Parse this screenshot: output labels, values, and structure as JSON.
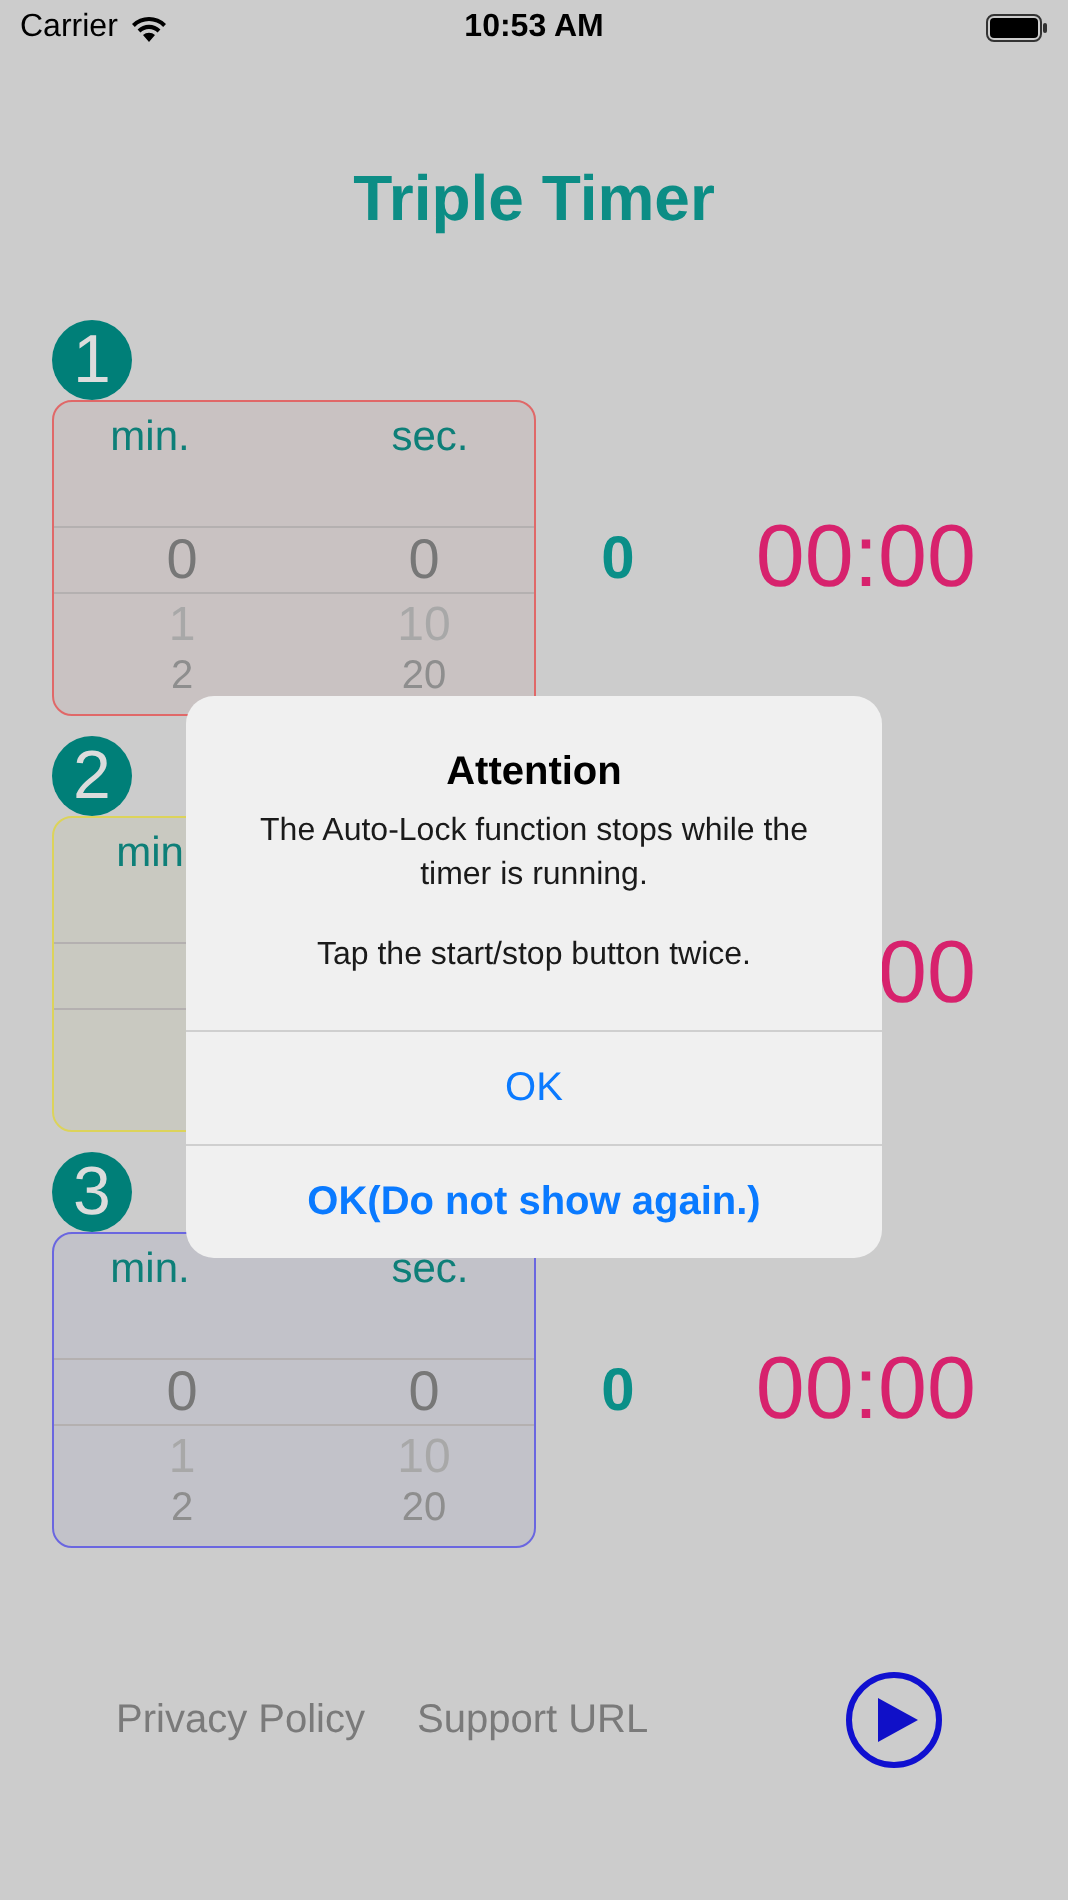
{
  "status_bar": {
    "carrier": "Carrier",
    "time": "10:53 AM"
  },
  "title": "Triple Timer",
  "timers": [
    {
      "number": "1",
      "color": "#e06868",
      "min_label": "min.",
      "sec_label": "sec.",
      "min_values": [
        "0",
        "1",
        "2"
      ],
      "sec_values": [
        "0",
        "10",
        "20"
      ],
      "count": "0",
      "time": "00:00"
    },
    {
      "number": "2",
      "color": "#dcd35a",
      "min_label": "min",
      "time": "00"
    },
    {
      "number": "3",
      "color": "#6a66e0",
      "min_label": "min.",
      "sec_label": "sec.",
      "min_values": [
        "0",
        "1",
        "2"
      ],
      "sec_values": [
        "0",
        "10",
        "20"
      ],
      "count": "0",
      "time": "00:00"
    }
  ],
  "footer": {
    "links": [
      "Privacy Policy",
      "Support URL"
    ]
  },
  "dialog": {
    "title": "Attention",
    "message": [
      "The Auto-Lock function stops while the timer is running.",
      "Tap the start/stop button twice."
    ],
    "buttons": [
      {
        "label": "OK",
        "kind": "default"
      },
      {
        "label": "OK(Do not show again.)",
        "kind": "bold"
      }
    ]
  }
}
